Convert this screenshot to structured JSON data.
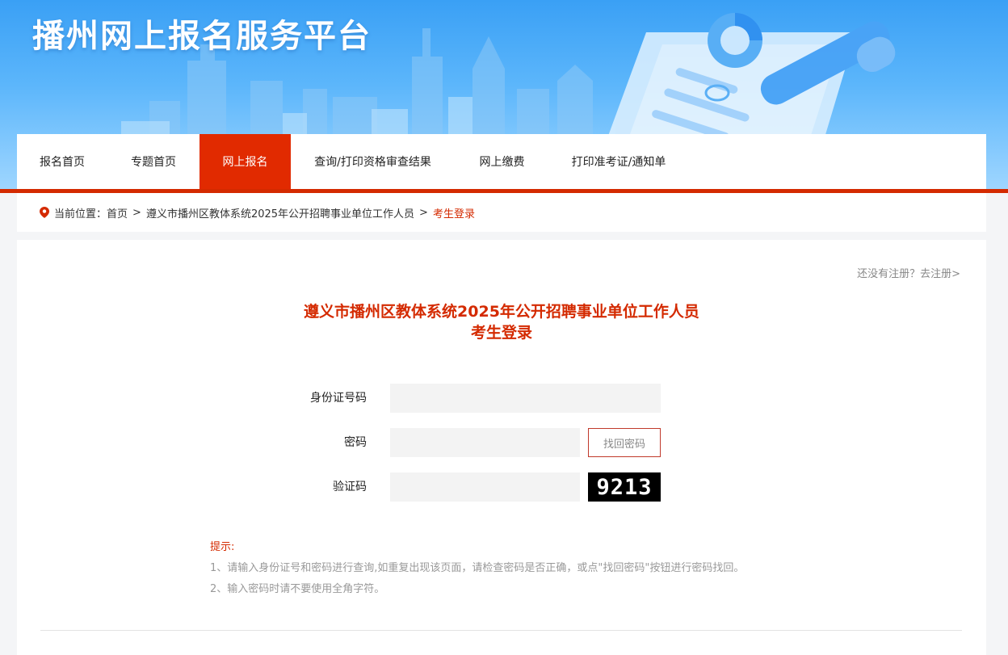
{
  "site": {
    "title": "播州网上报名服务平台"
  },
  "nav": {
    "items": [
      {
        "label": "报名首页"
      },
      {
        "label": "专题首页"
      },
      {
        "label": "网上报名"
      },
      {
        "label": "查询/打印资格审查结果"
      },
      {
        "label": "网上缴费"
      },
      {
        "label": "打印准考证/通知单"
      }
    ],
    "active_index": 2
  },
  "breadcrumb": {
    "prefix": "当前位置：",
    "home": "首页",
    "separator": ">",
    "exam": "遵义市播州区教体系统2025年公开招聘事业单位工作人员",
    "current": "考生登录"
  },
  "register_link": "还没有注册？去注册>",
  "form": {
    "title_line1": "遵义市播州区教体系统2025年公开招聘事业单位工作人员",
    "title_line2": "考生登录",
    "id_label": "身份证号码",
    "id_value": "",
    "password_label": "密码",
    "password_value": "",
    "find_password_label": "找回密码",
    "captcha_label": "验证码",
    "captcha_value": "",
    "captcha_image_text": "9213"
  },
  "tips": {
    "title": "提示:",
    "lines": [
      "1、请输入身份证号和密码进行查询,如重复出现该页面，请检查密码是否正确，或点\"找回密码\"按钮进行密码找回。",
      "2、输入密码时请不要使用全角字符。"
    ]
  },
  "colors": {
    "accent_red": "#e12a00",
    "banner_blue": "#3aa0f5",
    "title_red": "#d42a00"
  },
  "icons": {
    "location": "map-pin-icon"
  }
}
